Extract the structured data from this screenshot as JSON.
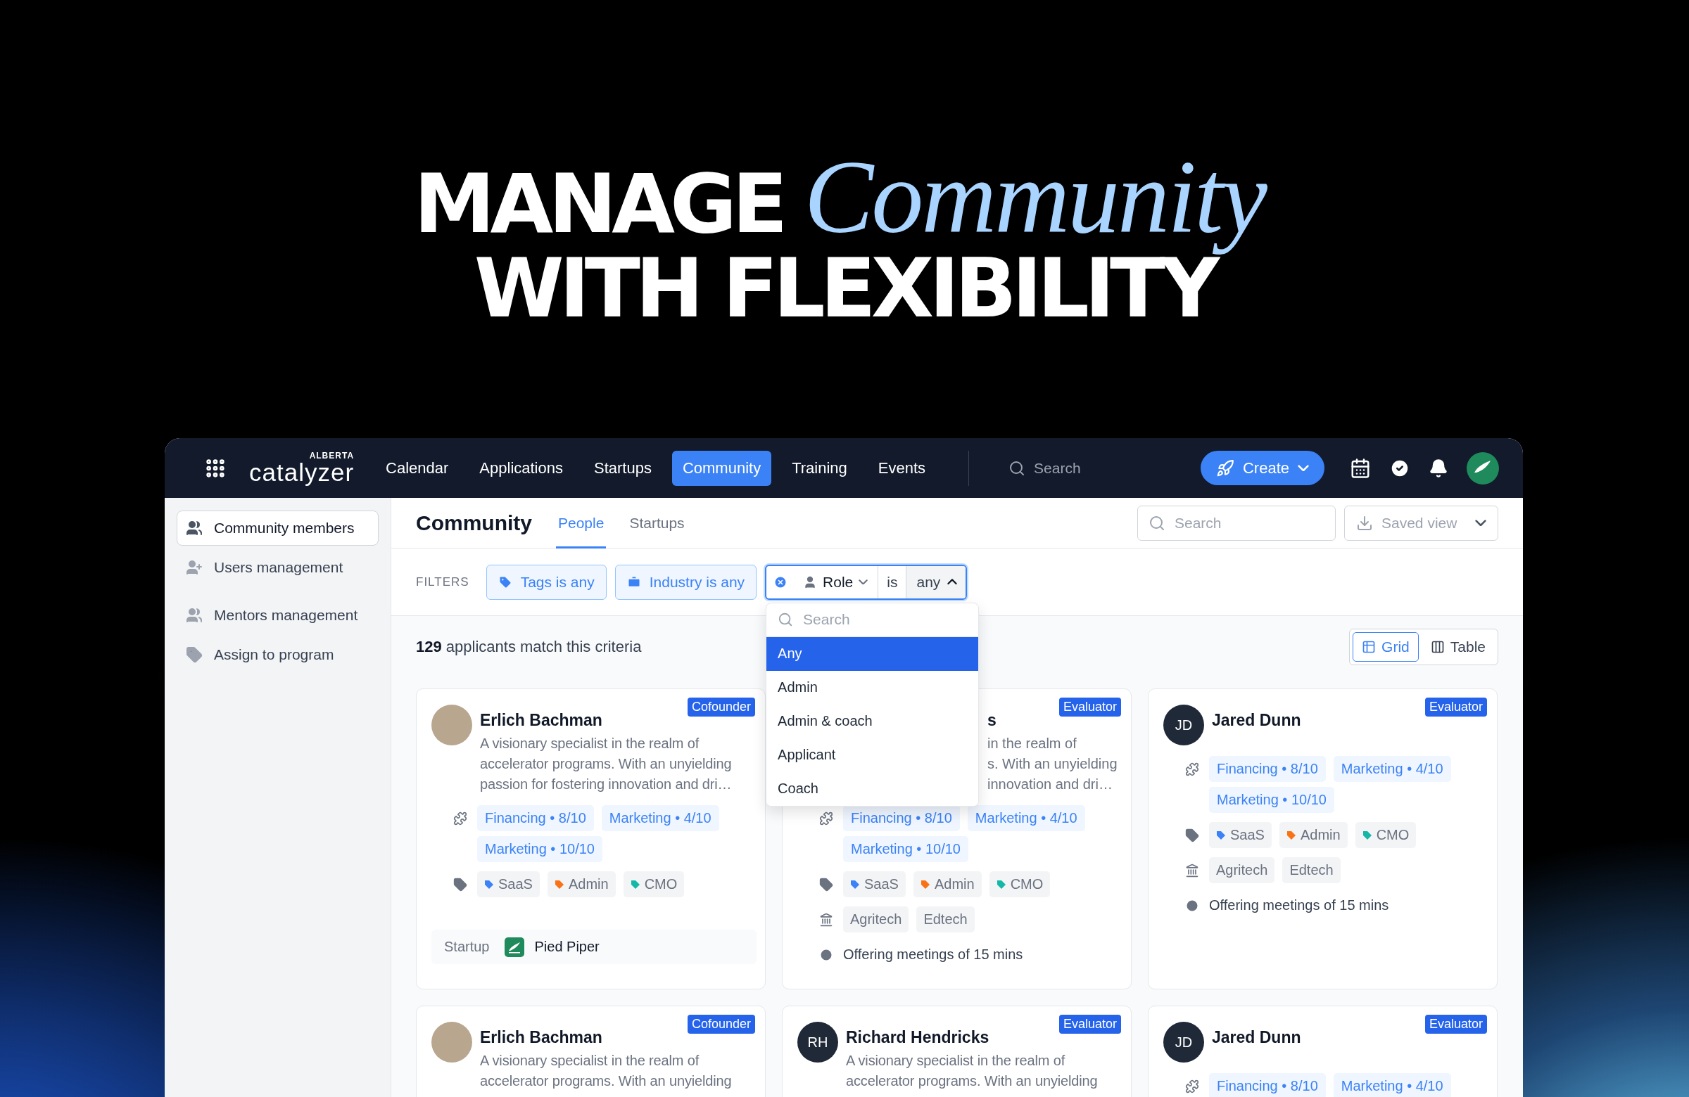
{
  "headline": {
    "line_1": "MANAGE",
    "line_1_script": "Community",
    "line_2": "WITH FLEXIBILITY"
  },
  "nav": {
    "logo_super": "ALBERTA",
    "logo": "catalyzer",
    "items": [
      {
        "label": "Calendar",
        "selected": false
      },
      {
        "label": "Applications",
        "selected": false
      },
      {
        "label": "Startups",
        "selected": false
      },
      {
        "label": "Community",
        "selected": true
      },
      {
        "label": "Training",
        "selected": false
      },
      {
        "label": "Events",
        "selected": false
      }
    ],
    "search_placeholder": "Search",
    "create_button": "Create"
  },
  "sidebar": {
    "groups": [
      [
        {
          "label": "Community members",
          "selected": true
        },
        {
          "label": "Users management",
          "selected": false
        }
      ],
      [
        {
          "label": "Mentors management",
          "selected": false
        },
        {
          "label": "Assign to program",
          "selected": false
        }
      ]
    ]
  },
  "page": {
    "title": "Community",
    "tabs": [
      {
        "label": "People",
        "selected": true
      },
      {
        "label": "Startups",
        "selected": false
      }
    ],
    "search_placeholder": "Search",
    "saved_view": "Saved view"
  },
  "filters": {
    "label": "FILTERS",
    "chips": [
      "Tags is any",
      "Industry is any"
    ],
    "role_filter": {
      "field": "Role",
      "operator": "is",
      "value": "any",
      "search_placeholder": "Search",
      "options": [
        {
          "label": "Any",
          "selected": true
        },
        {
          "label": "Admin",
          "selected": false
        },
        {
          "label": "Admin & coach",
          "selected": false
        },
        {
          "label": "Applicant",
          "selected": false
        },
        {
          "label": "Coach",
          "selected": false
        }
      ]
    }
  },
  "summary": "**129** applicants match this criteria",
  "view_toggle": [
    {
      "label": "Grid",
      "selected": true
    },
    {
      "label": "Table",
      "selected": false
    }
  ],
  "cards": [
    {
      "kind": "full",
      "avatar": {
        "kind": "photo"
      },
      "name": "Erlich Bachman",
      "role": "Cofounder",
      "description": "A visionary specialist in the realm of accelerator programs. With an unyielding passion for fostering innovation and dri…",
      "skills": [
        "Financing • 8/10",
        "Marketing • 4/10",
        "Marketing • 10/10"
      ],
      "tags": [
        {
          "label": "SaaS",
          "color": "#3b82f6"
        },
        {
          "label": "Admin",
          "color": "#f97316"
        },
        {
          "label": "CMO",
          "color": "#14b8a6"
        }
      ],
      "startup": {
        "label": "Startup",
        "name": "Pied Piper"
      }
    },
    {
      "kind": "covered",
      "name": "s",
      "role": "Evaluator",
      "description_lines": [
        "in the realm of",
        "s. With an unyielding",
        "innovation and dri…"
      ],
      "skills": [
        "Financing • 8/10",
        "Marketing • 4/10",
        "Marketing • 10/10"
      ],
      "tags": [
        {
          "label": "SaaS",
          "color": "#3b82f6"
        },
        {
          "label": "Admin",
          "color": "#f97316"
        },
        {
          "label": "CMO",
          "color": "#14b8a6"
        }
      ],
      "industries": [
        "Agritech",
        "Edtech"
      ],
      "meeting": "Offering meetings of 15 mins"
    },
    {
      "kind": "full",
      "avatar": {
        "kind": "initials",
        "text": "JD"
      },
      "name": "Jared Dunn",
      "role": "Evaluator",
      "skills": [
        "Financing • 8/10",
        "Marketing • 4/10",
        "Marketing • 10/10"
      ],
      "tags": [
        {
          "label": "SaaS",
          "color": "#3b82f6"
        },
        {
          "label": "Admin",
          "color": "#f97316"
        },
        {
          "label": "CMO",
          "color": "#14b8a6"
        }
      ],
      "industries": [
        "Agritech",
        "Edtech"
      ],
      "meeting": "Offering meetings of 15 mins"
    },
    {
      "kind": "full",
      "avatar": {
        "kind": "photo"
      },
      "name": "Erlich Bachman",
      "role": "Cofounder",
      "description": "A visionary specialist in the realm of accelerator programs. With an unyielding"
    },
    {
      "kind": "full",
      "avatar": {
        "kind": "initials",
        "text": "RH"
      },
      "name": "Richard Hendricks",
      "role": "Evaluator",
      "description": "A visionary specialist in the realm of accelerator programs. With an unyielding"
    },
    {
      "kind": "full",
      "avatar": {
        "kind": "initials",
        "text": "JD"
      },
      "name": "Jared Dunn",
      "role": "Evaluator",
      "skills": [
        "Financing • 8/10",
        "Marketing • 4/10"
      ]
    }
  ]
}
